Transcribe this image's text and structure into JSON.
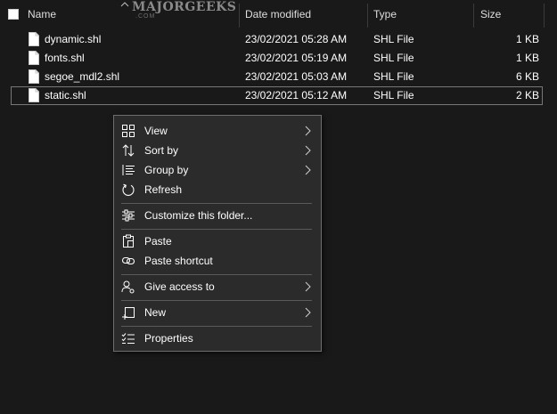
{
  "columns": {
    "name": "Name",
    "date_modified": "Date modified",
    "type": "Type",
    "size": "Size"
  },
  "watermark": {
    "title": "MAJORGEEKS",
    "sub": ".COM"
  },
  "files": [
    {
      "name": "dynamic.shl",
      "date": "23/02/2021 05:28 AM",
      "type": "SHL File",
      "size": "1 KB",
      "selected": false
    },
    {
      "name": "fonts.shl",
      "date": "23/02/2021 05:19 AM",
      "type": "SHL File",
      "size": "1 KB",
      "selected": false
    },
    {
      "name": "segoe_mdl2.shl",
      "date": "23/02/2021 05:03 AM",
      "type": "SHL File",
      "size": "6 KB",
      "selected": false
    },
    {
      "name": "static.shl",
      "date": "23/02/2021 05:12 AM",
      "type": "SHL File",
      "size": "2 KB",
      "selected": true
    }
  ],
  "context_menu": {
    "view": "View",
    "sort_by": "Sort by",
    "group_by": "Group by",
    "refresh": "Refresh",
    "customize": "Customize this folder...",
    "paste": "Paste",
    "paste_shortcut": "Paste shortcut",
    "give_access": "Give access to",
    "new": "New",
    "properties": "Properties"
  },
  "colors": {
    "background": "#191919",
    "menu_background": "#2b2b2b",
    "menu_border": "#6e6e6e",
    "text": "#ffffff",
    "selection_border": "#777777"
  }
}
